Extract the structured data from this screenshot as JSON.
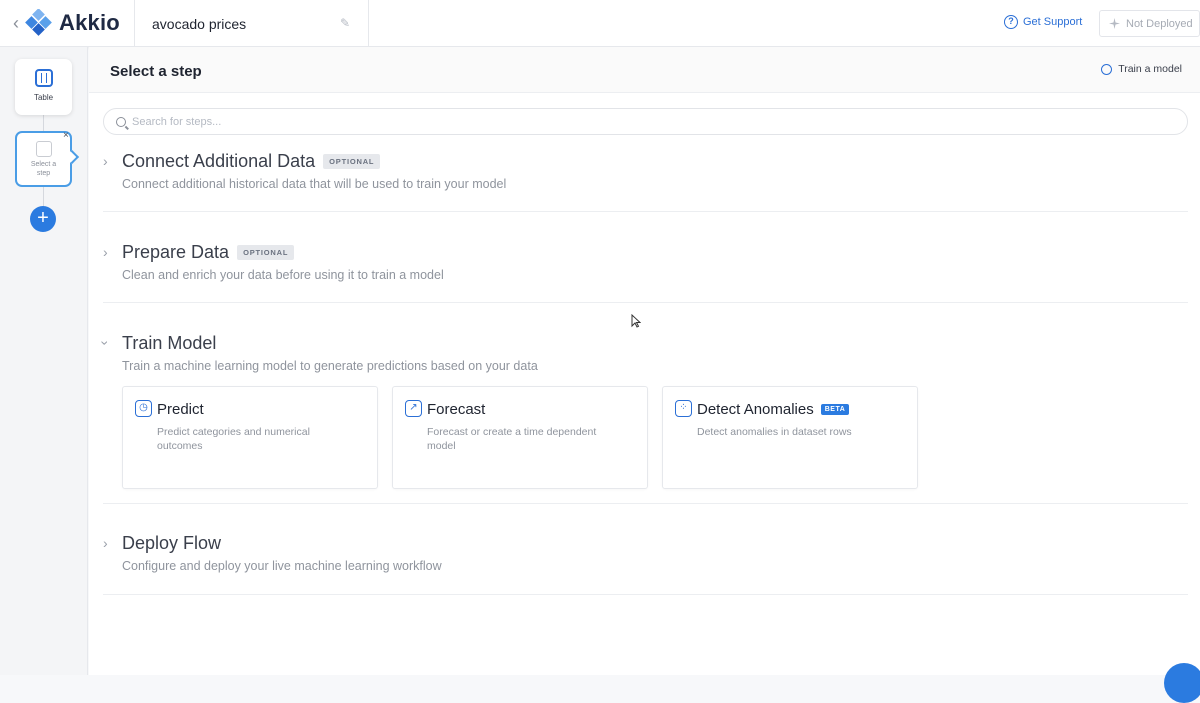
{
  "app": {
    "logo_text": "Akkio",
    "project_name": "avocado prices"
  },
  "topbar": {
    "support_label": "Get Support",
    "deploy_status": "Not Deployed"
  },
  "rail": {
    "nodes": [
      {
        "label": "Table",
        "icon": "table-icon"
      },
      {
        "label": "Select a step",
        "icon": "empty-step-icon"
      }
    ],
    "close_glyph": "×",
    "add_glyph": "+"
  },
  "main": {
    "title": "Select a step",
    "train_tag": "Train a model",
    "search_placeholder": "Search for steps...",
    "sections": [
      {
        "title": "Connect Additional Data",
        "badge": "OPTIONAL",
        "desc": "Connect additional historical data that will be used to train your model",
        "expanded": false
      },
      {
        "title": "Prepare Data",
        "badge": "OPTIONAL",
        "desc": "Clean and enrich your data before using it to train a model",
        "expanded": false
      },
      {
        "title": "Train Model",
        "badge": "",
        "desc": "Train a machine learning model to generate predictions based on your data",
        "expanded": true
      },
      {
        "title": "Deploy Flow",
        "badge": "",
        "desc": "Configure and deploy your live machine learning workflow",
        "expanded": false
      }
    ],
    "cards": [
      {
        "title": "Predict",
        "desc": "Predict categories and numerical outcomes",
        "icon": "predict-icon",
        "badge": ""
      },
      {
        "title": "Forecast",
        "desc": "Forecast or create a time dependent model",
        "icon": "forecast-icon",
        "badge": ""
      },
      {
        "title": "Detect Anomalies",
        "desc": "Detect anomalies in dataset rows",
        "icon": "anomaly-icon",
        "badge": "BETA"
      }
    ]
  },
  "colors": {
    "accent": "#2b6fd6",
    "button_blue": "#2b7be0",
    "node_border": "#4a9de6"
  }
}
